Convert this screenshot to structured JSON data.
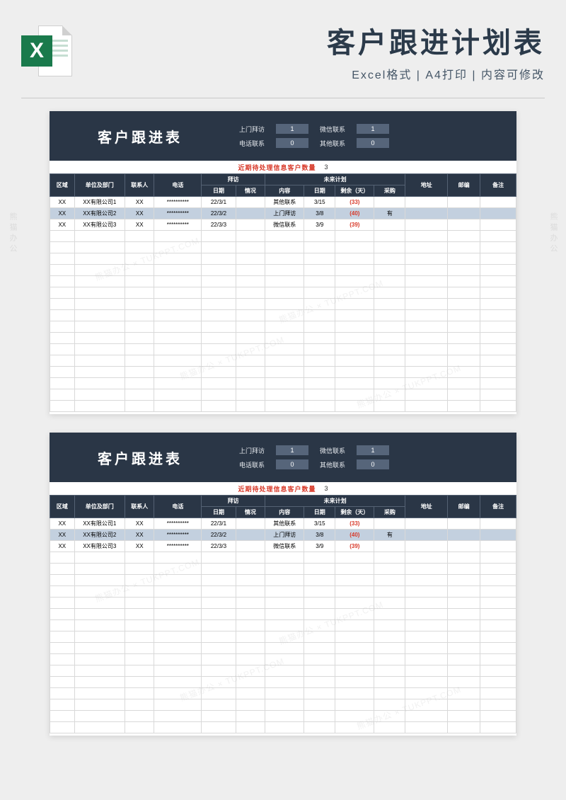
{
  "banner": {
    "title": "客户跟进计划表",
    "subtitle": "Excel格式 | A4打印 | 内容可修改",
    "icon_letter": "X"
  },
  "sheet": {
    "title": "客户跟进表",
    "stats": {
      "visit_label": "上门拜访",
      "visit_val": "1",
      "wechat_label": "微信联系",
      "wechat_val": "1",
      "phone_label": "电话联系",
      "phone_val": "0",
      "other_label": "其他联系",
      "other_val": "0"
    },
    "pending_label": "近期待处理信息客户数量",
    "pending_count": "3",
    "columns": {
      "c1": "区域",
      "c2": "单位及部门",
      "c3": "联系人",
      "c4": "电话",
      "c5_group": "拜访",
      "c5a": "日期",
      "c5b": "情况",
      "c6_group": "未来计划",
      "c6a": "内容",
      "c6b": "日期",
      "c6c": "剩余（天）",
      "c6d": "采购",
      "c7": "地址",
      "c8": "邮编",
      "c9": "备注"
    },
    "rows": [
      {
        "area": "XX",
        "unit": "XX有限公司1",
        "contact": "XX",
        "phone": "**********",
        "v_date": "22/3/1",
        "v_situ": "",
        "p_content": "其他联系",
        "p_date": "3/15",
        "p_remain": "(33)",
        "p_buy": "",
        "addr": "",
        "zip": "",
        "note": "",
        "hi": false
      },
      {
        "area": "XX",
        "unit": "XX有限公司2",
        "contact": "XX",
        "phone": "**********",
        "v_date": "22/3/2",
        "v_situ": "",
        "p_content": "上门拜访",
        "p_date": "3/8",
        "p_remain": "(40)",
        "p_buy": "有",
        "addr": "",
        "zip": "",
        "note": "",
        "hi": true
      },
      {
        "area": "XX",
        "unit": "XX有限公司3",
        "contact": "XX",
        "phone": "**********",
        "v_date": "22/3/3",
        "v_situ": "",
        "p_content": "微信联系",
        "p_date": "3/9",
        "p_remain": "(39)",
        "p_buy": "",
        "addr": "",
        "zip": "",
        "note": "",
        "hi": false
      }
    ]
  },
  "watermark": "熊猫办公 × TUKPPT.COM",
  "side_watermark": "熊猫办公"
}
